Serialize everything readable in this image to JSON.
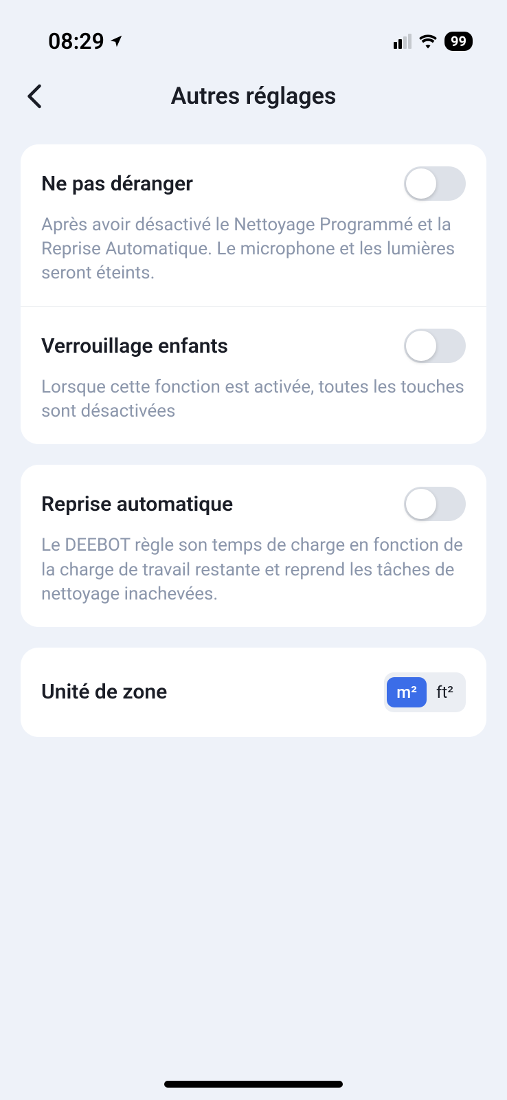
{
  "statusBar": {
    "time": "08:29",
    "battery": "99"
  },
  "header": {
    "title": "Autres réglages"
  },
  "settings": {
    "dnd": {
      "title": "Ne pas déranger",
      "description": "Après avoir désactivé le Nettoyage Programmé et la Reprise Automatique. Le microphone et les lumières seront éteints.",
      "enabled": false
    },
    "childLock": {
      "title": "Verrouillage enfants",
      "description": "Lorsque cette fonction est activée, toutes les touches sont désactivées",
      "enabled": false
    },
    "autoResume": {
      "title": "Reprise automatique",
      "description": "Le DEEBOT règle son temps de charge en fonction de la charge de travail restante et reprend les tâches de nettoyage inachevées.",
      "enabled": false
    },
    "areaUnit": {
      "title": "Unité de zone",
      "options": {
        "m2": "m²",
        "ft2": "ft²"
      },
      "selected": "m2"
    }
  }
}
